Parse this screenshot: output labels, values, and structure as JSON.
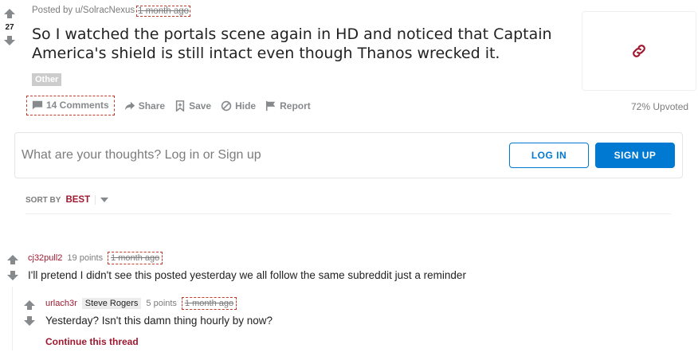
{
  "post": {
    "score": "27",
    "posted_by": "Posted by u/SolracNexus",
    "age": "1 month ago",
    "title": "So I watched the portals scene again in HD and noticed that Captain America's shield is still intact even though Thanos wrecked it.",
    "flair": "Other",
    "upvoted": "72% Upvoted"
  },
  "actions": {
    "comments": "14 Comments",
    "share": "Share",
    "save": "Save",
    "hide": "Hide",
    "report": "Report"
  },
  "comment_box": {
    "placeholder": "What are your thoughts? Log in or Sign up",
    "login": "LOG IN",
    "signup": "SIGN UP"
  },
  "sort": {
    "label": "SORT BY",
    "value": "BEST"
  },
  "comments": [
    {
      "author": "cj32pull2",
      "points": "19 points",
      "age": "1 month ago",
      "text": "I'll pretend I didn't see this posted yesterday we all follow the same subreddit just a reminder"
    },
    {
      "author": "urlach3r",
      "flair": "Steve Rogers",
      "points": "5 points",
      "age": "1 month ago",
      "text": "Yesterday? Isn't this damn thing hourly by now?",
      "continue": "Continue this thread"
    }
  ],
  "colors": {
    "accent_red": "#a0182f",
    "button_blue": "#0079d3",
    "link_icon": "#a0182f"
  }
}
